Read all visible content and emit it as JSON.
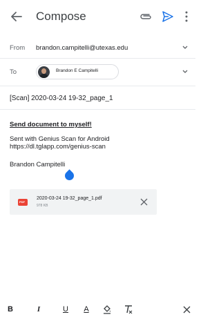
{
  "appbar": {
    "title": "Compose"
  },
  "from": {
    "label": "From",
    "value": "brandon.campitelli@utexas.edu"
  },
  "to": {
    "label": "To",
    "chip_name": "Brandon E Campitelli"
  },
  "subject": "[Scan] 2020-03-24 19-32_page_1",
  "body": {
    "heading": "Send document to myself!",
    "line1": "Sent with Genius Scan for Android",
    "line2": "https://dl.tglapp.com/genius-scan",
    "signature": "Brandon Campitelli"
  },
  "attachment": {
    "type_label": "PDF",
    "filename": "2020-03-24 19-32_page_1.pdf",
    "size": "978 KB"
  },
  "toolbar": {
    "bold": "B",
    "italic": "I",
    "underline": "U",
    "text_color": "A"
  },
  "colors": {
    "accent": "#1a73e8",
    "pdf_red": "#ea4335"
  }
}
